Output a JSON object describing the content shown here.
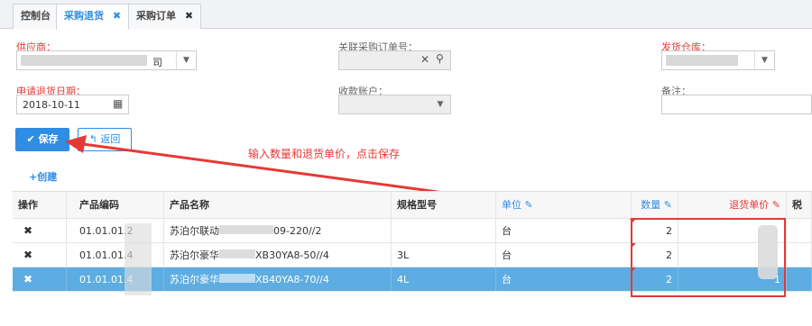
{
  "tabs": [
    {
      "label": "控制台",
      "closable": false,
      "active": false
    },
    {
      "label": "采购退货",
      "closable": true,
      "active": true
    },
    {
      "label": "采购订单",
      "closable": true,
      "active": false
    }
  ],
  "close_glyph": "✖",
  "form": {
    "supplier_label": "供应商：",
    "supplier_value_tail": "司",
    "related_order_label": "关联采购订单号：",
    "warehouse_label": "发货仓库：",
    "return_date_label": "申请退货日期：",
    "return_date_value": "2018-10-11",
    "receive_account_label": "收款账户：",
    "remark_label": "备注："
  },
  "actions": {
    "save_label": "保存",
    "back_label": "返回",
    "create_label": "+创建"
  },
  "annotation": "输入数量和退货单价，点击保存",
  "table": {
    "headers": {
      "op": "操作",
      "code": "产品编码",
      "name": "产品名称",
      "spec": "规格型号",
      "unit": "单位",
      "qty": "数量",
      "price": "退货单价",
      "tax": "税"
    },
    "rows": [
      {
        "code": "01.01.01.2",
        "name_head": "苏泊尔联动",
        "name_tail": "09-220//2",
        "spec": "",
        "unit": "台",
        "qty": "2",
        "price": ""
      },
      {
        "code": "01.01.01.4",
        "name_head": "苏泊尔豪华",
        "name_tail": "XB30YA8-50//4",
        "spec": "3L",
        "unit": "台",
        "qty": "2",
        "price": ""
      },
      {
        "code": "01.01.01.4",
        "name_head": "苏泊尔豪华",
        "name_tail": "XB40YA8-70//4",
        "spec": "4L",
        "unit": "台",
        "qty": "2",
        "price": "1"
      }
    ]
  },
  "colors": {
    "accent": "#2f8de4",
    "required": "#e53935",
    "selected_row": "#5dade2"
  }
}
